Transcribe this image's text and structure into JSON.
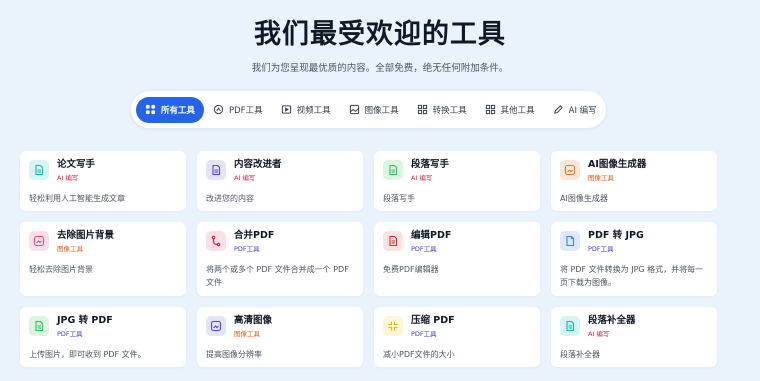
{
  "header": {
    "title": "我们最受欢迎的工具",
    "subtitle": "我们为您呈现最优质的内容。全部免费，绝无任何附加条件。"
  },
  "tabs": [
    {
      "label": "所有工具",
      "icon": "grid-icon",
      "active": true
    },
    {
      "label": "PDF工具",
      "icon": "pdf-tool-icon",
      "active": false
    },
    {
      "label": "视频工具",
      "icon": "video-icon",
      "active": false
    },
    {
      "label": "图像工具",
      "icon": "image-icon",
      "active": false
    },
    {
      "label": "转换工具",
      "icon": "convert-icon",
      "active": false
    },
    {
      "label": "其他工具",
      "icon": "apps-icon",
      "active": false
    },
    {
      "label": "AI 编写",
      "icon": "pen-icon",
      "active": false
    }
  ],
  "cards": [
    {
      "title": "论文写手",
      "category": "AI 编写",
      "desc": "轻松利用人工智能生成文章",
      "icon": "document-icon",
      "tint": "teal"
    },
    {
      "title": "内容改进者",
      "category": "AI 编写",
      "desc": "改进您的内容",
      "icon": "document-icon",
      "tint": "indigo"
    },
    {
      "title": "段落写手",
      "category": "AI 编写",
      "desc": "段落写手",
      "icon": "document-icon",
      "tint": "green"
    },
    {
      "title": "AI图像生成器",
      "category": "图像工具",
      "desc": "AI图像生成器",
      "icon": "image-icon",
      "tint": "peach"
    },
    {
      "title": "去除图片背景",
      "category": "图像工具",
      "desc": "轻松去除图片背景",
      "icon": "image-icon",
      "tint": "pink"
    },
    {
      "title": "合并PDF",
      "category": "PDF工具",
      "desc": "将两个或多个 PDF 文件合并成一个 PDF 文件",
      "icon": "merge-icon",
      "tint": "rose"
    },
    {
      "title": "编辑PDF",
      "category": "PDF工具",
      "desc": "免费PDF编辑器",
      "icon": "document-icon",
      "tint": "red"
    },
    {
      "title": "PDF 转 JPG",
      "category": "PDF工具",
      "desc": "将 PDF 文件转换为 JPG 格式，并将每一页下载为图像。",
      "icon": "file-icon",
      "tint": "blue"
    },
    {
      "title": "JPG 转 PDF",
      "category": "PDF工具",
      "desc": "上传图片，即可收到 PDF 文件。",
      "icon": "document-icon",
      "tint": "green"
    },
    {
      "title": "高清图像",
      "category": "图像工具",
      "desc": "提高图像分辨率",
      "icon": "image-icon",
      "tint": "indigo"
    },
    {
      "title": "压缩 PDF",
      "category": "PDF工具",
      "desc": "减小PDF文件的大小",
      "icon": "compress-icon",
      "tint": "yellow"
    },
    {
      "title": "段落补全器",
      "category": "AI 编写",
      "desc": "段落补全器",
      "icon": "document-icon",
      "tint": "teal"
    }
  ],
  "colors": {
    "accent": "#2563eb",
    "background": "#eaf3fc",
    "ai_category": "#e11d48",
    "image_category": "#ea580c",
    "pdf_category": "#4338ca"
  }
}
